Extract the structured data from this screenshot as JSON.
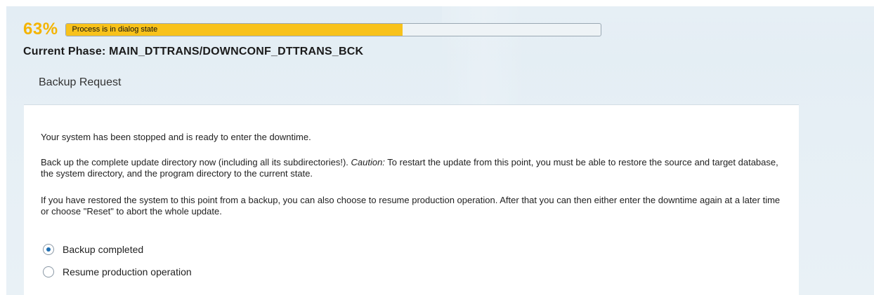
{
  "progress": {
    "percent_label": "63%",
    "percent_value": 0.63,
    "status_text": "Process is in dialog state",
    "accent_color": "#f8c21b"
  },
  "phase": {
    "label": "Current Phase: MAIN_DTTRANS/DOWNCONF_DTTRANS_BCK"
  },
  "section": {
    "title": "Backup Request"
  },
  "content": {
    "para1": "Your system has been stopped and is ready to enter the downtime.",
    "para2_before": "Back up the complete update directory now (including all its subdirectories!). ",
    "para2_caution": "Caution:",
    "para2_after": " To restart the update from this point, you must be able to restore the source and target database, the system directory, and the program directory to the current state.",
    "para3": "If you have restored the system to this point from a backup, you can also choose to resume production operation. After that you can then either enter the downtime again at a later time or choose \"Reset\" to abort the whole update."
  },
  "options": [
    {
      "label": "Backup completed",
      "selected": true
    },
    {
      "label": "Resume production operation",
      "selected": false
    }
  ]
}
